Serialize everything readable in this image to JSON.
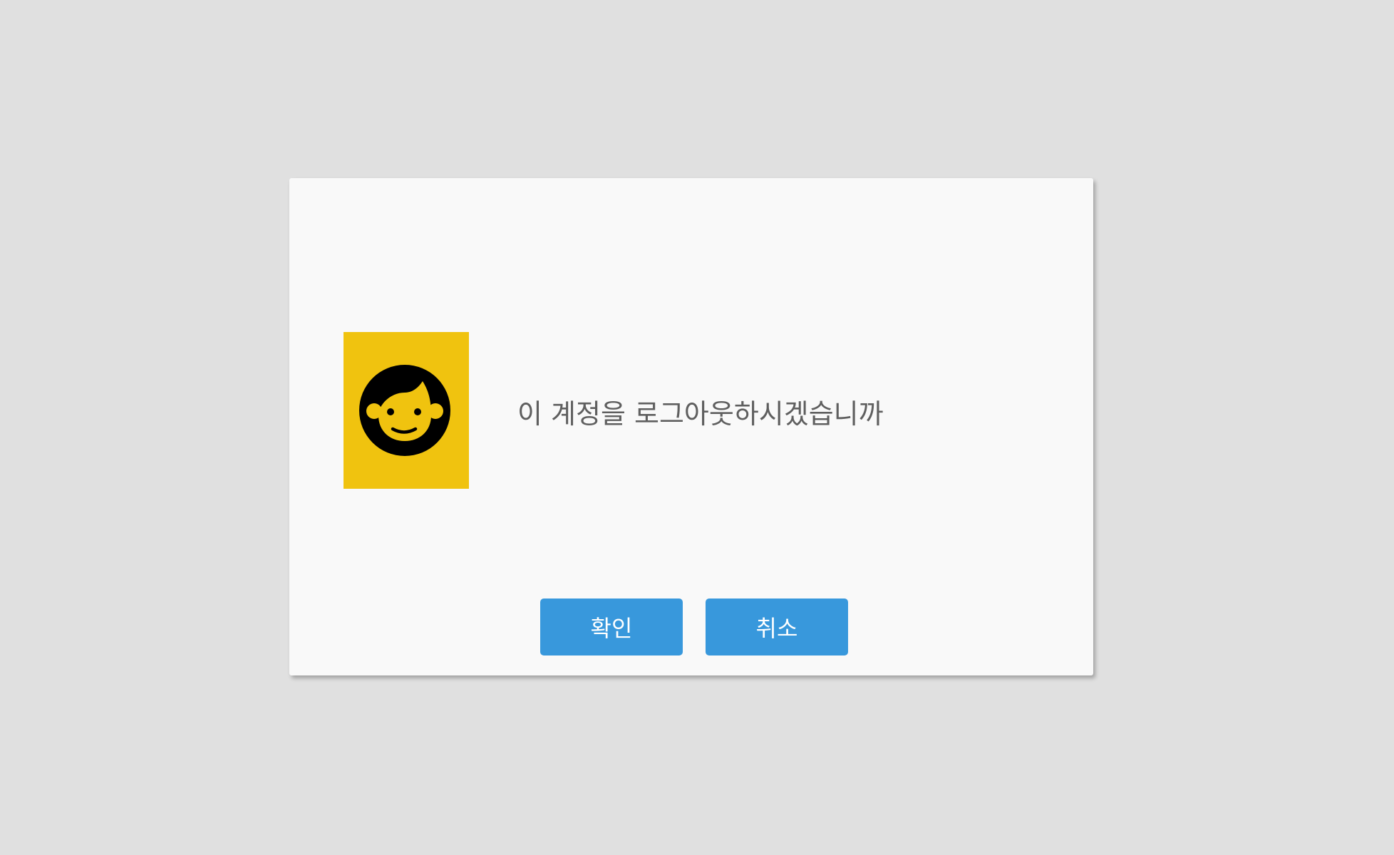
{
  "dialog": {
    "message": "이 계정을 로그아웃하시겠습니까",
    "avatar": {
      "icon": "face-icon",
      "background_color": "#f0c30f"
    },
    "buttons": {
      "confirm_label": "확인",
      "cancel_label": "취소",
      "color": "#3898dc"
    }
  }
}
